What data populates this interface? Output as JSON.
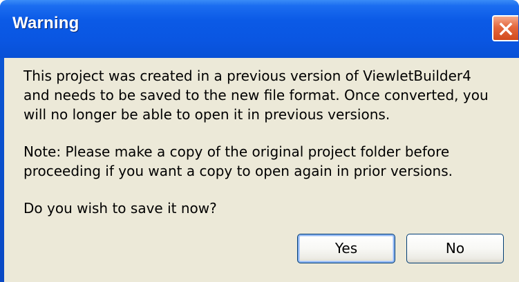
{
  "dialog": {
    "title": "Warning",
    "paragraphs": [
      "This project was created in a previous version of ViewletBuilder4 and needs to be saved to the new file format. Once converted, you will no longer be able to open it in previous versions.",
      "Note: Please make a copy of the original project folder before proceeding if you want a copy to open again in prior versions.",
      "Do you wish to save it now?"
    ],
    "buttons": {
      "yes": "Yes",
      "no": "No"
    },
    "close_icon": "close-icon"
  },
  "colors": {
    "titlebar": "#0a56e2",
    "client_background": "#ece9d8",
    "close_button": "#e4683e",
    "button_border": "#003c74"
  }
}
